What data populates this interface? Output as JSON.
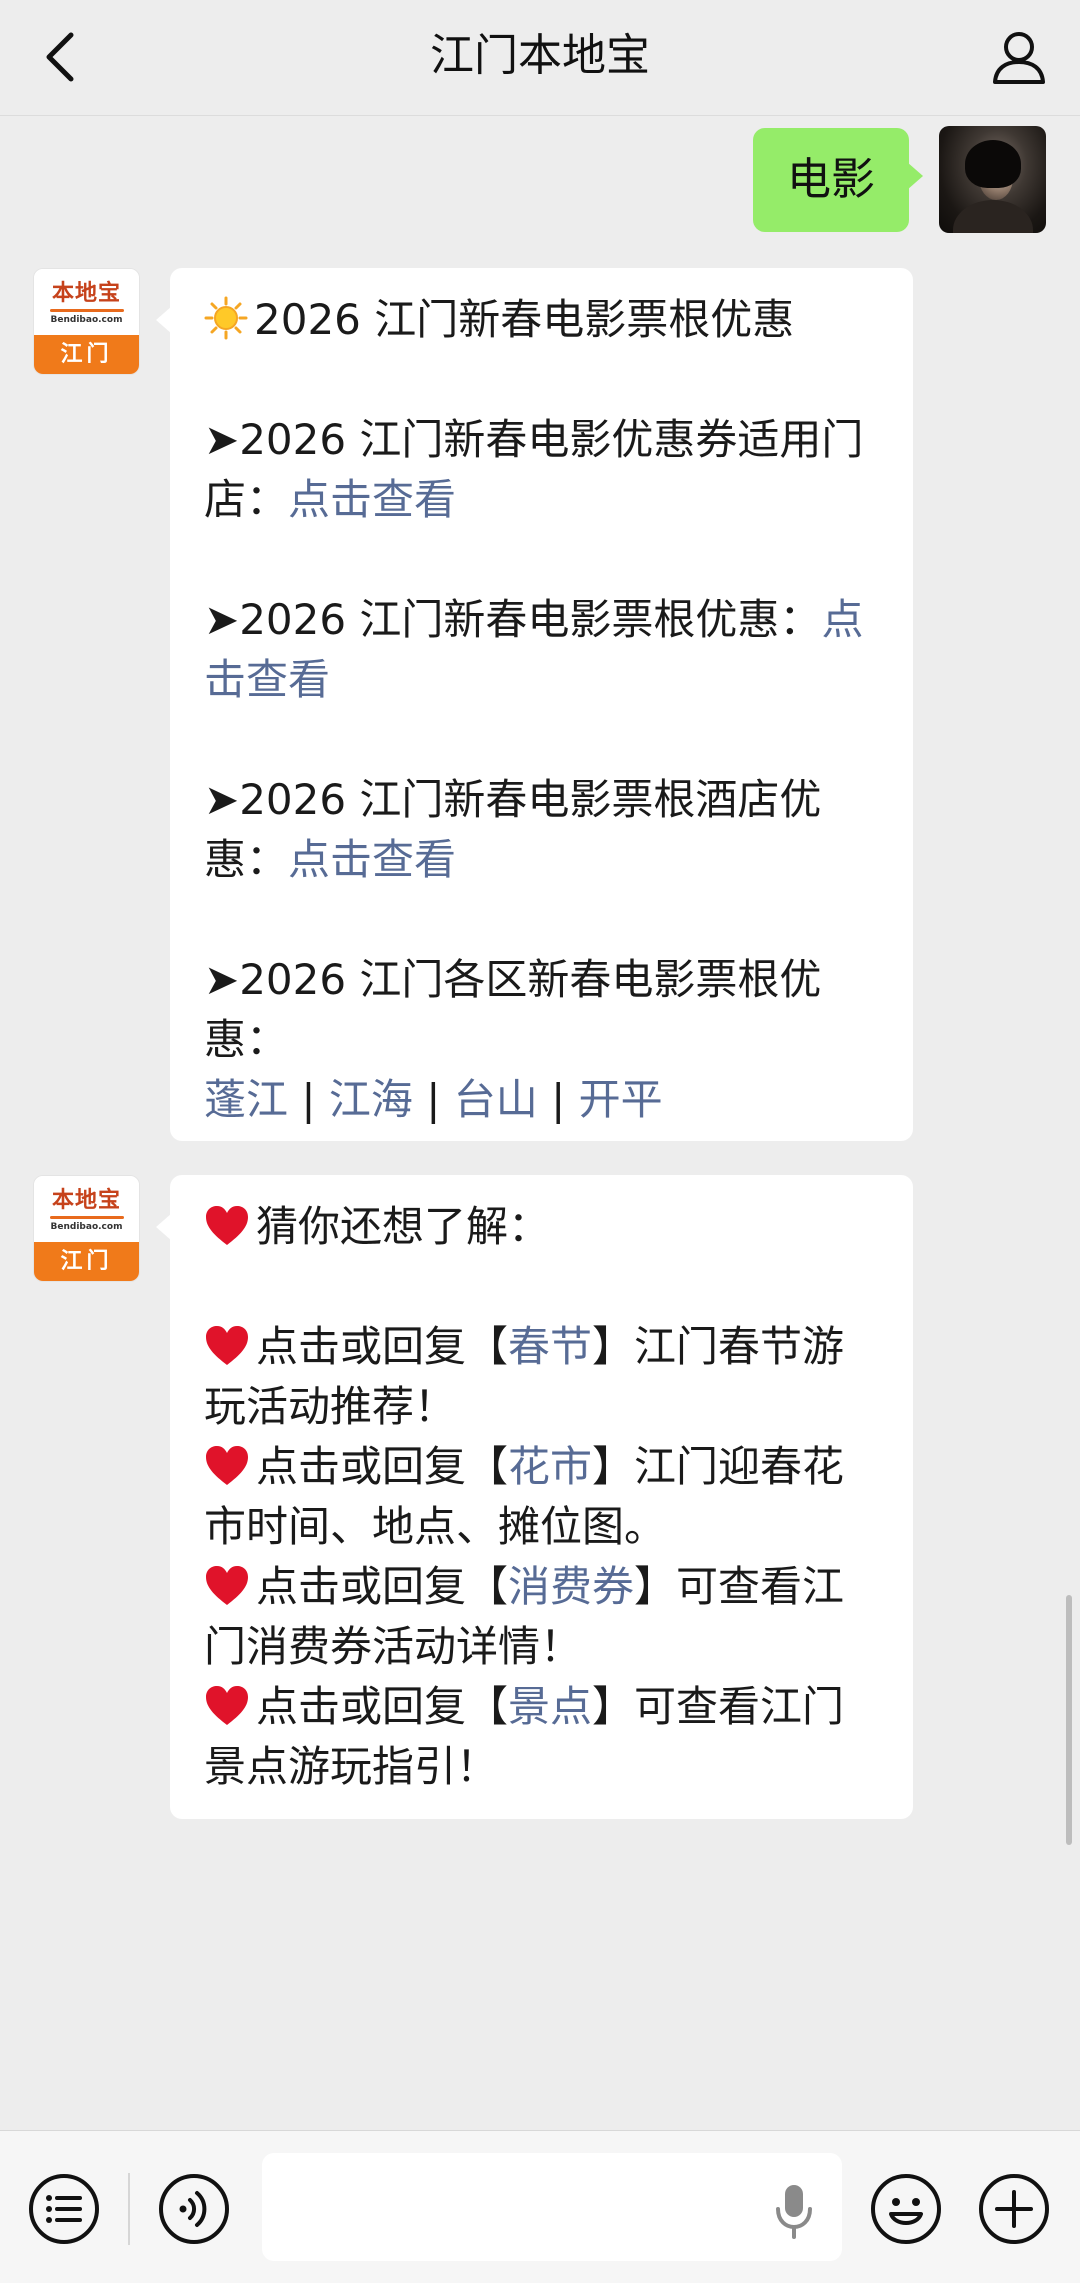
{
  "header": {
    "title": "江门本地宝"
  },
  "outgoing": {
    "text": "电影"
  },
  "bot": {
    "logo_name": "本地宝",
    "logo_url": "Bendibao.com",
    "logo_city": "江门"
  },
  "message1": {
    "title": "2026 江门新春电影票根优惠",
    "item1_text": "➤2026 江门新春电影优惠券适用门店：",
    "item1_link": "点击查看",
    "item2_text": "➤2026 江门新春电影票根优惠：",
    "item2_link": "点击查看",
    "item3_text": "➤2026 江门新春电影票根酒店优惠：",
    "item3_link": "点击查看",
    "item4_text": "➤2026 江门各区新春电影票根优惠：",
    "districts": [
      "蓬江",
      "江海",
      "台山",
      "开平"
    ],
    "separator": "|"
  },
  "message2": {
    "intro": "猜你还想了解：",
    "items": [
      {
        "prefix": "点击或回复【",
        "keyword": "春节",
        "suffix": "】江门春节游玩活动推荐！"
      },
      {
        "prefix": "点击或回复【",
        "keyword": "花市",
        "suffix": "】江门迎春花市时间、地点、摊位图。"
      },
      {
        "prefix": "点击或回复【",
        "keyword": "消费券",
        "suffix": "】可查看江门消费券活动详情！"
      },
      {
        "prefix": "点击或回复【",
        "keyword": "景点",
        "suffix": "】可查看江门景点游玩指引！"
      }
    ]
  },
  "colors": {
    "link": "#576b95",
    "outgoing_bubble": "#95ec69",
    "background": "#ededed",
    "logo_orange": "#f07a1a"
  },
  "icons": [
    "back-arrow-icon",
    "user-icon",
    "sun-icon",
    "heart-icon",
    "menu-list-icon",
    "voice-icon",
    "microphone-icon",
    "emoji-icon",
    "plus-icon"
  ]
}
